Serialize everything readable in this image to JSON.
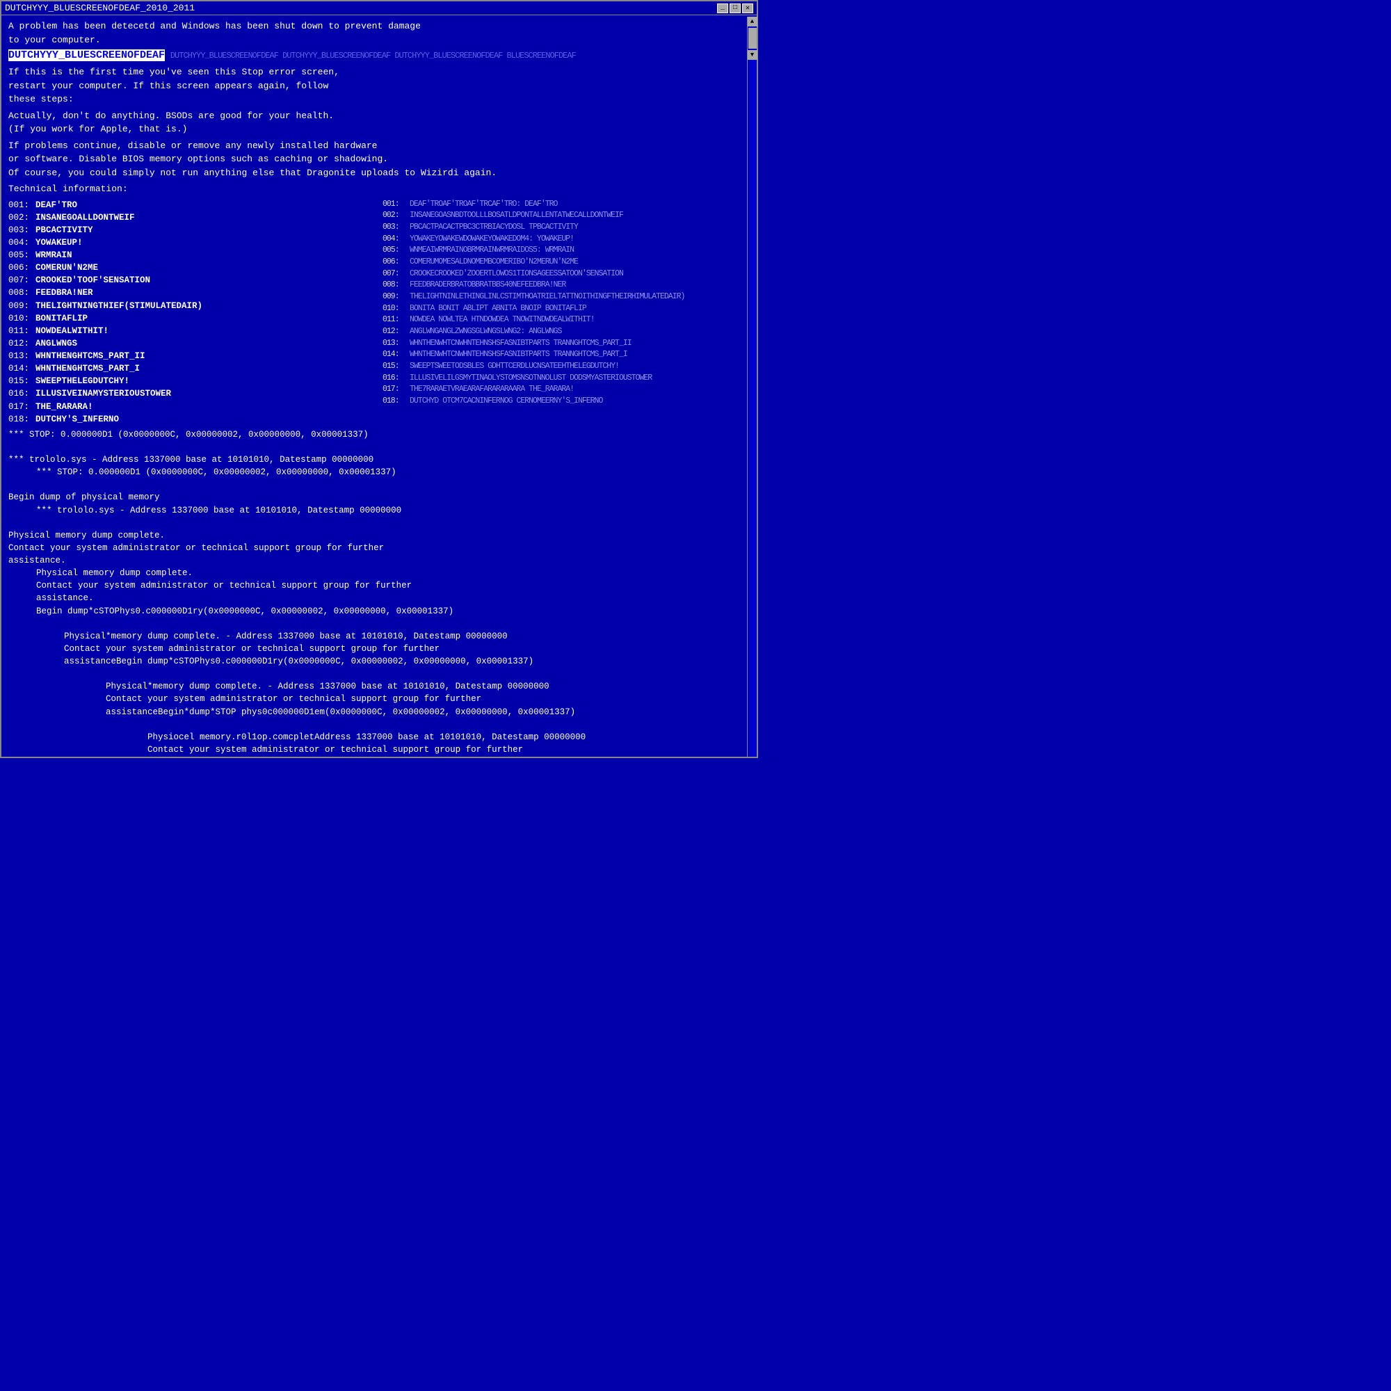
{
  "window": {
    "title": "DUTCHYYY_BLUESCREENOFDEAF_2010_2011",
    "buttons": [
      "_",
      "□",
      "✕"
    ]
  },
  "content": {
    "intro": [
      "A problem has been detecetd and Windows has been shut down to prevent damage",
      "to your computer."
    ],
    "main_title": "DUTCHYYY_BLUESCREENOFDEAF",
    "main_title_glitch": "DUTCHYYY_BLUESCREENOFDEAF DUTCHYYY_BLUESCREENOFDEAF DUTCHYYY_BLUESCREENOFDEAF BLUESCREENOFDEAF",
    "paragraphs": [
      "If this is the first time you've seen this Stop error screen,\nrestart your computer. If this screen appears again, follow\nthese steps:",
      "Actually, don't do anything. BSODs are good for your health.\n(If you work for Apple, that is.)",
      "If problems continue, disable or remove any newly installed hardware\nor software. Disable BIOS memory options such as caching or shadowing.\nOf course, you could simply not run anything else that Dragonite uploads to Wizirdi again."
    ],
    "tech_header": "Technical information:",
    "errors": [
      {
        "num": "001:",
        "label": "DEAF'TRO"
      },
      {
        "num": "002:",
        "label": "INSANEGOALLDONTWEIF"
      },
      {
        "num": "003:",
        "label": "PBCACTIVITY"
      },
      {
        "num": "004:",
        "label": "YOWAKEUP!"
      },
      {
        "num": "005:",
        "label": "WRMRAIN"
      },
      {
        "num": "006:",
        "label": "COMERUN'N2ME"
      },
      {
        "num": "007:",
        "label": "CROOKED'TOOF'SENSATION"
      },
      {
        "num": "008:",
        "label": "FEEDBRA!NER"
      },
      {
        "num": "009:",
        "label": "THELIGHTNINGTHIEF(STIMULATEDAIR)"
      },
      {
        "num": "010:",
        "label": "BONITAFLIP"
      },
      {
        "num": "011:",
        "label": "NOWDEALWITHIT!"
      },
      {
        "num": "012:",
        "label": "ANGLWNGS"
      },
      {
        "num": "013:",
        "label": "WHNTHENGHTCMS_PART_II"
      },
      {
        "num": "014:",
        "label": "WHNTHENGHTCMS_PART_I"
      },
      {
        "num": "015:",
        "label": "SWEEPTHELEGDUTCHY!"
      },
      {
        "num": "016:",
        "label": "ILLUSIVEINAMYSTERIOUSTOWER"
      },
      {
        "num": "017:",
        "label": "THE_RARARA!"
      },
      {
        "num": "018:",
        "label": "DUTCHY'S_INFERNO"
      }
    ],
    "errors_right": [
      {
        "num": "001:",
        "label": "DEAF'TROAF'TROAF'TRCAF'TRO: DEAF'TRO"
      },
      {
        "num": "002:",
        "label": "INSANEGOASNBDTOOLLLBOSATLDPONTALLENTATWECALLDONTWEIF"
      },
      {
        "num": "003:",
        "label": "PBCACTPACACTPBC3CTRBIACYDOSL TPBCACTIVITY"
      },
      {
        "num": "004:",
        "label": "YOWAKEYOWAKEWDOWAKEYOWAKEDOM4: YOWAKEUP!"
      },
      {
        "num": "005:",
        "label": "WNMEAIWRMRAINOBRMRAINWRMRAIDOS5: WRMRAIN"
      },
      {
        "num": "006:",
        "label": "COMERUMOMESALDNOMEMBCOMERIBO'N2MERUN'N2ME"
      },
      {
        "num": "007:",
        "label": "CROOKECROOKED'ZOOERTLOWOS1TIONSAGEESSATOON'SENSATION"
      },
      {
        "num": "008:",
        "label": "FEEDBRADERBRATOBBRATBBS40NEFEEDBRA!NER"
      },
      {
        "num": "009:",
        "label": "THELIGHTNINLETHINGLINLCSTIMTHOATRIELTATTNOITHINGFTHEIRHIMULATEDAIR)"
      },
      {
        "num": "010:",
        "label": "BONITA BONIT ABLIPT ABNITA BNOIP BONITAFLIP"
      },
      {
        "num": "011:",
        "label": "NOWDEA NOWLTEA HTNDOWDEA TNOWITNDWDEALWITHIT!"
      },
      {
        "num": "012:",
        "label": "ANGLWNGANGLZWNGSGLWNGSLWNG2: ANGLWNGS"
      },
      {
        "num": "013:",
        "label": "WHNTHENWHTCNWHNTEHNSHSFASNIBTPARTS TRANNGHTCMS_PART_II"
      },
      {
        "num": "014:",
        "label": "WHNTHENWHTCNWHNTEHNSHSFASNIBTPARTS TRANNGHTCMS_PART_I"
      },
      {
        "num": "015:",
        "label": "SWEEPTSWEETODSBLES GDHTTCERDLUCNSATEEHTHELEGDUTCHY!"
      },
      {
        "num": "016:",
        "label": "ILLUSIVELILGSMYTINAOLYSTOMSNSOTNNOLUST DODSMYASTERIOUSTOWER"
      },
      {
        "num": "017:",
        "label": "THE7RARAETVRAEARAFARARARAARA THE_RARARA!"
      },
      {
        "num": "018:",
        "label": "DUTCHYD OTCM7CACNINFERNOG CERNOMEERNY'S_INFERNO"
      }
    ],
    "stop_line": "*** STOP: 0.000000D1 (0x0000000C, 0x00000002, 0x00000000, 0x00001337)",
    "trololo_line": "***      trololo.sys - Address 1337000 base at 10101010, Datestamp 00000000",
    "stop_line2": "      *** STOP: 0.000000D1 (0x0000000C, 0x00000002, 0x00000000, 0x00001337)",
    "dump_blocks": [
      {
        "indent": 0,
        "lines": [
          "Begin dump of physical memory",
          "***      trololo.sys - Address 1337000 base at 10101010, Datestamp 00000000"
        ]
      },
      {
        "indent": 0,
        "lines": [
          "Physical memory dump complete.",
          "Contact your system administrator or technical support group for further",
          "assistance."
        ]
      }
    ],
    "repeating_dump": [
      "Begin dump of physical memory",
      "***      trololo.sys - Address 1337000 base at 10101010, Datestamp 00000000",
      "Physical memory dump complete.",
      "Contact your system administrator or technical support group for further",
      "assistance."
    ]
  }
}
